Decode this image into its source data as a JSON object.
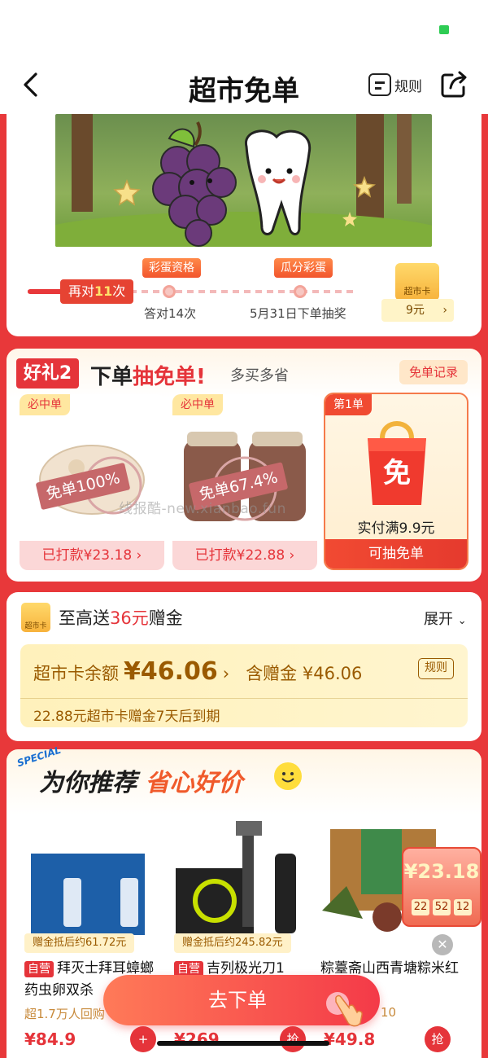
{
  "nav": {
    "title": "超市免单",
    "rules_label": "规则"
  },
  "game": {
    "current_prefix": "再对",
    "current_count": "11",
    "current_suffix": "次",
    "milestone1_tag": "彩蛋资格",
    "milestone1_caption": "答对14次",
    "milestone2_tag": "瓜分彩蛋",
    "milestone2_caption": "5月31日下单抽奖",
    "card_label": "超市卡",
    "card_value": "9元"
  },
  "gift": {
    "badge": "好礼2",
    "title_pre": "下单",
    "title_highlight": "抽免单",
    "title_post": "!",
    "subtitle": "多买多省",
    "record_label": "免单记录",
    "products": [
      {
        "tag": "必中单",
        "stamp": "免单100%",
        "footer": "已打款¥23.18 ›"
      },
      {
        "tag": "必中单",
        "stamp": "免单67.4%",
        "footer": "已打款¥22.88 ›"
      }
    ],
    "third": {
      "tag": "第1单",
      "icon_char": "免",
      "condition": "实付满9.9元",
      "footer": "可抽免单"
    }
  },
  "watermark": "线报酷-new.xianbao.fun",
  "balance": {
    "icon_label": "超市卡",
    "title_pre": "至高送",
    "title_amount": "36元",
    "title_post": "赠金",
    "expand_label": "展开",
    "label": "超市卡余额",
    "amount": "¥46.06",
    "arrow": "›",
    "gift_label": "含赠金 ¥46.06",
    "rule_label": "规则",
    "expiry_note": "22.88元超市卡赠金7天后到期"
  },
  "recommend": {
    "special": "SPECIAL",
    "title_pre": "为你推荐",
    "title_highlight": "省心好价",
    "products": [
      {
        "subsidy": "赠金抵后约61.72元",
        "self_tag": "自营",
        "name": "拜灭士拜耳蟑螂药虫卵双杀",
        "sold": "超1.7万人回购",
        "price": "¥84.9",
        "action": "+"
      },
      {
        "subsidy": "赠金抵后约245.82元",
        "self_tag": "自营",
        "name": "吉列极光刀1",
        "sold": "",
        "price": "¥269",
        "action": "抢"
      },
      {
        "subsidy": "",
        "self_tag": "",
        "name": "粽薹斋山西青塘粽米红枣…",
        "sold": "10",
        "price": "¥49.8",
        "action": "抢"
      }
    ]
  },
  "timer": {
    "amount": "¥23.18",
    "h": "22",
    "m": "52",
    "s": "12"
  },
  "cta_label": "去下单",
  "colors": {
    "brand_red": "#e8383a",
    "gold": "#9a5a00"
  }
}
